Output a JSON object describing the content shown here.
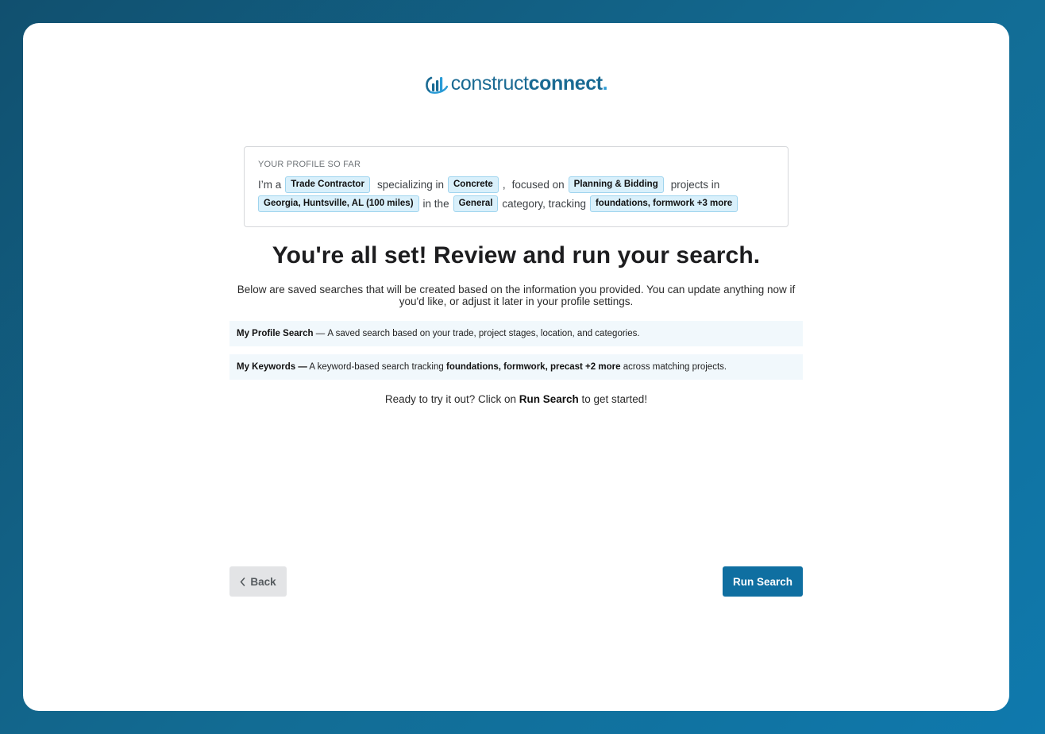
{
  "logo": {
    "light": "construct",
    "bold": "connect",
    "dot": "."
  },
  "profile": {
    "heading": "YOUR PROFILE SO FAR",
    "line1": {
      "t1": "I’m a",
      "chip1": "Trade Contractor",
      "t2": "specializing in",
      "chip2": "Concrete",
      "t3": ",",
      "t4": "focused on",
      "chip3": "Planning & Bidding",
      "t5": "projects in"
    },
    "line2": {
      "chip1": "Georgia, Huntsville, AL (100 miles)",
      "t1": "in the",
      "chip2": "General",
      "t2": "category, tracking",
      "chip3": "foundations, formwork +3 more"
    }
  },
  "title": "You're all set! Review and run your search.",
  "description": "Below are saved searches that will be created based on the information you provided. You can update anything now if you'd like, or adjust it later in your profile settings.",
  "searches": [
    {
      "name": "My Profile Search",
      "sep": " — ",
      "text": "A saved search based on your trade, project stages, location, and categories."
    },
    {
      "name": "My Keywords —",
      "text_before": " A keyword-based search tracking ",
      "keywords": "foundations, formwork, precast +2 more",
      "text_after": " across matching projects."
    }
  ],
  "ready": {
    "before": "Ready to try it out? Click on ",
    "action": "Run Search",
    "after": " to get started!"
  },
  "buttons": {
    "back": "Back",
    "run": "Run Search"
  },
  "colors": {
    "brand": "#1a6a93",
    "primary_button": "#0f6fa1",
    "chip_bg": "#d9f0fb"
  }
}
